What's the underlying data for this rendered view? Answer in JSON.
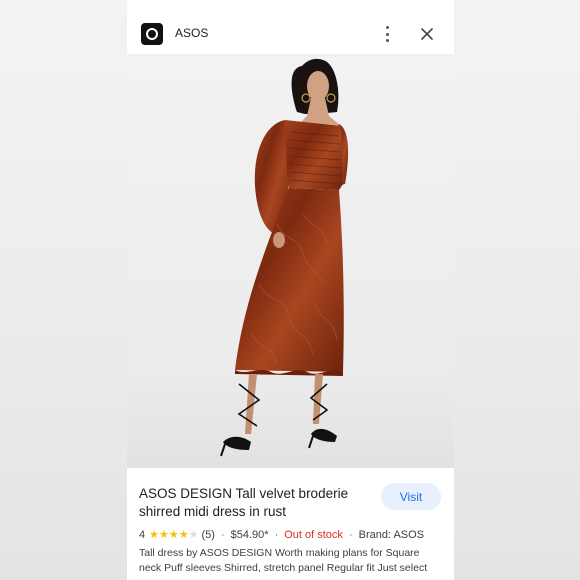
{
  "header": {
    "site_name": "ASOS",
    "logo_icon": "asos-logo-icon",
    "more_icon": "more-vert-icon",
    "close_icon": "close-icon"
  },
  "product": {
    "image_alt": "Model wearing rust velvet midi dress with puff sleeves and black strappy heels",
    "title": "ASOS DESIGN Tall velvet broderie shirred midi dress in rust",
    "visit_label": "Visit",
    "rating_value": "4",
    "rating": 4,
    "rating_max": 5,
    "review_count": "(5)",
    "price": "$54.90*",
    "stock_status": "Out of stock",
    "brand": "Brand: ASOS",
    "description": "Tall dress by ASOS DESIGN Worth making plans for Square neck Puff sleeves Shirred, stretch panel Regular fit Just select"
  },
  "colors": {
    "accent": "#1a73e8",
    "accent_bg": "#e8f0fe",
    "out_of_stock": "#d93025",
    "star": "#fbbc04",
    "dress": "#8e3214"
  }
}
